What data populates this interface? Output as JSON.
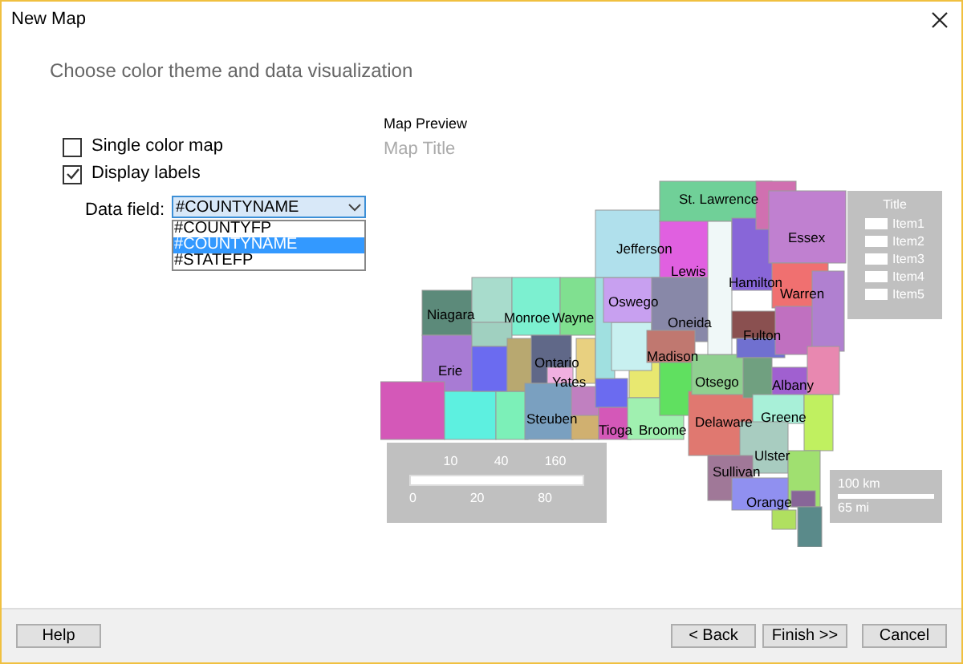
{
  "window": {
    "title": "New Map"
  },
  "header": {
    "subtitle": "Choose color theme and data visualization"
  },
  "options": [
    {
      "label": "Single color map",
      "checked": false
    },
    {
      "label": "Display labels",
      "checked": true
    }
  ],
  "data_field": {
    "label": "Data field:",
    "value": "#COUNTYNAME",
    "expanded": true,
    "options": [
      {
        "label": "#COUNTYFP",
        "selected": false
      },
      {
        "label": "#COUNTYNAME",
        "selected": true
      },
      {
        "label": "#STATEFP",
        "selected": false
      }
    ]
  },
  "preview": {
    "heading": "Map Preview",
    "map_title": "Map Title",
    "county_labels": [
      "St. Lawrence",
      "Jefferson",
      "Lewis",
      "Hamilton",
      "Essex",
      "Warren",
      "Oswego",
      "Oneida",
      "Niagara",
      "Monroe",
      "Wayne",
      "Fulton",
      "Madison",
      "Ontario",
      "Erie",
      "Yates",
      "Otsego",
      "Albany",
      "Steuben",
      "Greene",
      "Tioga",
      "Broome",
      "Delaware",
      "Ulster",
      "Sullivan",
      "Orange"
    ],
    "legend": {
      "title": "Title",
      "items": [
        "Item1",
        "Item2",
        "Item3",
        "Item4",
        "Item5"
      ]
    },
    "scale_bar": {
      "top_ticks": [
        "10",
        "40",
        "160"
      ],
      "bottom_ticks": [
        "0",
        "20",
        "80"
      ]
    },
    "distance": {
      "km": "100 km",
      "mi": "65 mi"
    }
  },
  "footer": {
    "buttons": [
      "Help",
      "< Back",
      "Finish >>",
      "Cancel"
    ]
  }
}
